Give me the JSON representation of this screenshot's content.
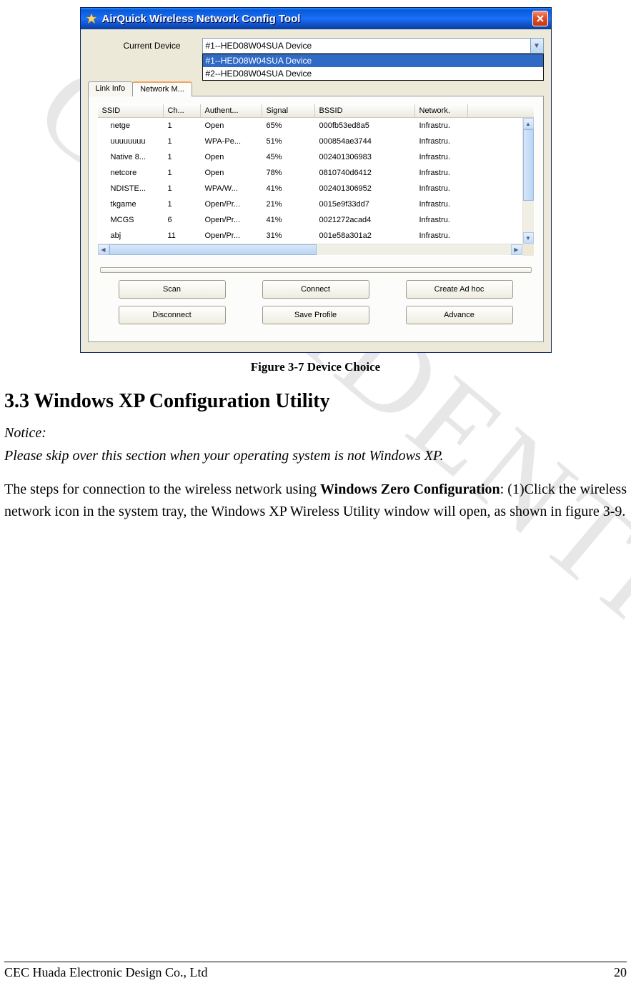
{
  "window": {
    "title": "AirQuick Wireless Network Config Tool",
    "close_label": "X"
  },
  "device": {
    "label": "Current Device",
    "selected": "#1--HED08W04SUA Device",
    "options": [
      "#1--HED08W04SUA Device",
      "#2--HED08W04SUA Device"
    ]
  },
  "tabs": {
    "link_info": "Link Info",
    "network_m": "Network M..."
  },
  "grid": {
    "headers": {
      "ssid": "SSID",
      "ch": "Ch...",
      "auth": "Authent...",
      "signal": "Signal",
      "bssid": "BSSID",
      "network": "Network."
    },
    "rows": [
      {
        "ssid": "netge",
        "ch": "1",
        "auth": "Open",
        "signal": "65%",
        "bssid": "000fb53ed8a5",
        "network": "Infrastru."
      },
      {
        "ssid": "uuuuuuuu",
        "ch": "1",
        "auth": "WPA-Pe...",
        "signal": "51%",
        "bssid": "000854ae3744",
        "network": "Infrastru."
      },
      {
        "ssid": "Native 8...",
        "ch": "1",
        "auth": "Open",
        "signal": "45%",
        "bssid": "002401306983",
        "network": "Infrastru."
      },
      {
        "ssid": "netcore",
        "ch": "1",
        "auth": "Open",
        "signal": "78%",
        "bssid": "0810740d6412",
        "network": "Infrastru."
      },
      {
        "ssid": "NDISTE...",
        "ch": "1",
        "auth": "WPA/W...",
        "signal": "41%",
        "bssid": "002401306952",
        "network": "Infrastru."
      },
      {
        "ssid": "tkgame",
        "ch": "1",
        "auth": "Open/Pr...",
        "signal": "21%",
        "bssid": "0015e9f33dd7",
        "network": "Infrastru."
      },
      {
        "ssid": "MCGS",
        "ch": "6",
        "auth": "Open/Pr...",
        "signal": "41%",
        "bssid": "0021272acad4",
        "network": "Infrastru."
      },
      {
        "ssid": "abj",
        "ch": "11",
        "auth": "Open/Pr...",
        "signal": "31%",
        "bssid": "001e58a301a2",
        "network": "Infrastru."
      }
    ]
  },
  "buttons": {
    "scan": "Scan",
    "connect": "Connect",
    "create_adhoc": "Create Ad hoc",
    "disconnect": "Disconnect",
    "save_profile": "Save Profile",
    "advance": "Advance"
  },
  "caption": "Figure 3-7 Device Choice",
  "section_heading": "3.3 Windows XP Configuration Utility",
  "notice_label": "Notice:",
  "notice_text": "Please skip over this section when your operating system is not Windows XP.",
  "body_para_1a": "The steps for connection to the wireless network using ",
  "body_para_1b_bold": "Windows Zero Configuration",
  "body_para_1c": ": (1)Click the wireless network icon in the system tray, the Windows XP Wireless Utility window will open, as shown in figure 3-9.",
  "watermark": "CONFIDENTIAL",
  "footer": {
    "company": "CEC Huada Electronic Design Co., Ltd",
    "page": "20"
  }
}
